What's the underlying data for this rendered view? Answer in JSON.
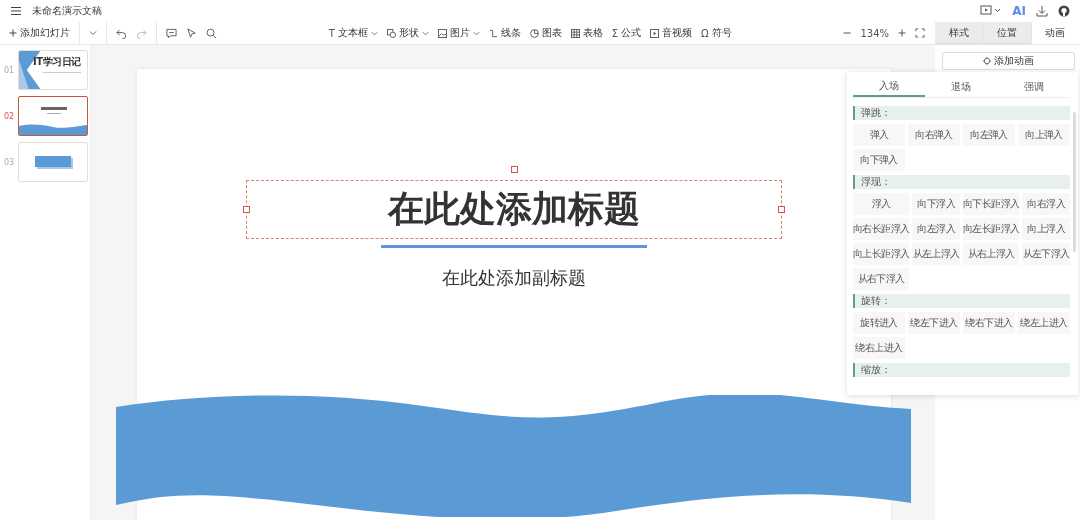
{
  "document_title": "未命名演示文稿",
  "top_actions": {
    "ai_label": "AI"
  },
  "toolbar": {
    "add_slide": "添加幻灯片",
    "insert_tools": [
      {
        "kind": "char",
        "glyph": "T",
        "label": "文本框",
        "dropdown": true
      },
      {
        "kind": "shape",
        "label": "形状",
        "dropdown": true
      },
      {
        "kind": "image",
        "label": "图片",
        "dropdown": true
      },
      {
        "kind": "line",
        "label": "线条",
        "dropdown": false
      },
      {
        "kind": "chart",
        "label": "图表",
        "dropdown": false
      },
      {
        "kind": "table",
        "label": "表格",
        "dropdown": false
      },
      {
        "kind": "char",
        "glyph": "Σ",
        "label": "公式",
        "dropdown": false
      },
      {
        "kind": "media",
        "label": "音视频",
        "dropdown": false
      },
      {
        "kind": "char",
        "glyph": "Ω",
        "label": "符号",
        "dropdown": false
      }
    ],
    "zoom": "134%"
  },
  "panel_tabs": [
    {
      "label": "样式",
      "selected": false
    },
    {
      "label": "位置",
      "selected": false
    },
    {
      "label": "动画",
      "selected": true
    }
  ],
  "slides": [
    {
      "number": "01",
      "selected": false,
      "kind": "cover",
      "title": "IT学习日记"
    },
    {
      "number": "02",
      "selected": true,
      "kind": "title"
    },
    {
      "number": "03",
      "selected": false,
      "kind": "banner"
    }
  ],
  "slide": {
    "title": "在此处添加标题",
    "subtitle": "在此处添加副标题",
    "title_selected": true
  },
  "add_animation": "添加动画",
  "animation_popup": {
    "tabs": [
      {
        "label": "入场",
        "selected": true
      },
      {
        "label": "退场",
        "selected": false
      },
      {
        "label": "强调",
        "selected": false
      }
    ],
    "groups": [
      {
        "name": "弹跳：",
        "effects": [
          "弹入",
          "向右弹入",
          "向左弹入",
          "向上弹入",
          "向下弹入"
        ]
      },
      {
        "name": "浮现：",
        "effects": [
          "浮入",
          "向下浮入",
          "向下长距浮入",
          "向右浮入",
          "向右长距浮入",
          "向左浮入",
          "向左长距浮入",
          "向上浮入",
          "向上长距浮入",
          "从左上浮入",
          "从右上浮入",
          "从左下浮入",
          "从右下浮入"
        ]
      },
      {
        "name": "旋转：",
        "effects": [
          "旋转进入",
          "绕左下进入",
          "绕右下进入",
          "绕左上进入",
          "绕右上进入"
        ]
      },
      {
        "name": "缩放："
      }
    ]
  }
}
